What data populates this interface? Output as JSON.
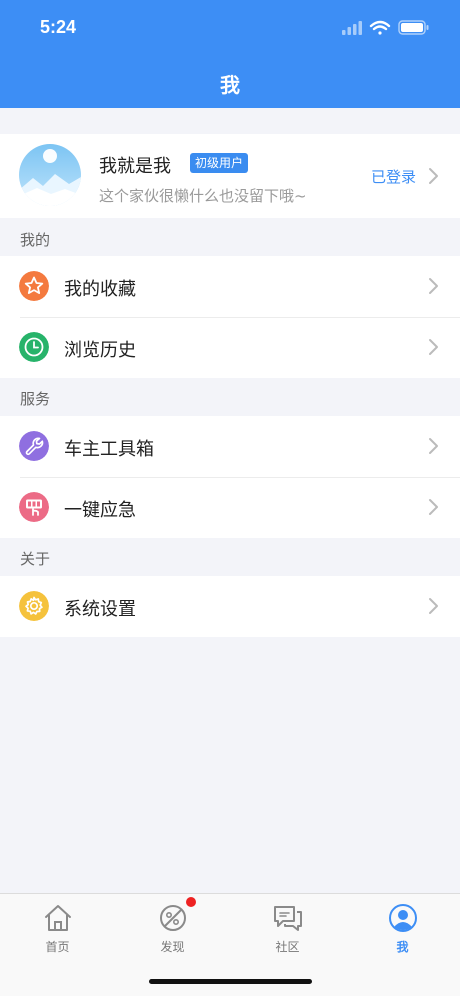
{
  "status_bar": {
    "time": "5:24"
  },
  "nav": {
    "title": "我"
  },
  "profile": {
    "name": "我就是我",
    "level": "初级用户",
    "bio": "这个家伙很懒什么也没留下哦~",
    "login_status": "已登录"
  },
  "sections": [
    {
      "title": "我的",
      "items": [
        {
          "label": "我的收藏",
          "icon": "star-icon",
          "color": "#f47a3f"
        },
        {
          "label": "浏览历史",
          "icon": "clock-icon",
          "color": "#27b36a"
        }
      ]
    },
    {
      "title": "服务",
      "items": [
        {
          "label": "车主工具箱",
          "icon": "wrench-icon",
          "color": "#8f6fe0"
        },
        {
          "label": "一键应急",
          "icon": "sos-icon",
          "color": "#ec6b86"
        }
      ]
    },
    {
      "title": "关于",
      "items": [
        {
          "label": "系统设置",
          "icon": "gear-icon",
          "color": "#f5c23c"
        }
      ]
    }
  ],
  "tabbar": {
    "tabs": [
      {
        "label": "首页",
        "icon": "home-icon",
        "active": false
      },
      {
        "label": "发现",
        "icon": "discover-icon",
        "active": false,
        "has_badge": true
      },
      {
        "label": "社区",
        "icon": "community-icon",
        "active": false
      },
      {
        "label": "我",
        "icon": "user-icon",
        "active": true
      }
    ]
  },
  "colors": {
    "primary": "#3d8ef5",
    "background": "#f3f4f9",
    "badge": "#ee2222"
  }
}
